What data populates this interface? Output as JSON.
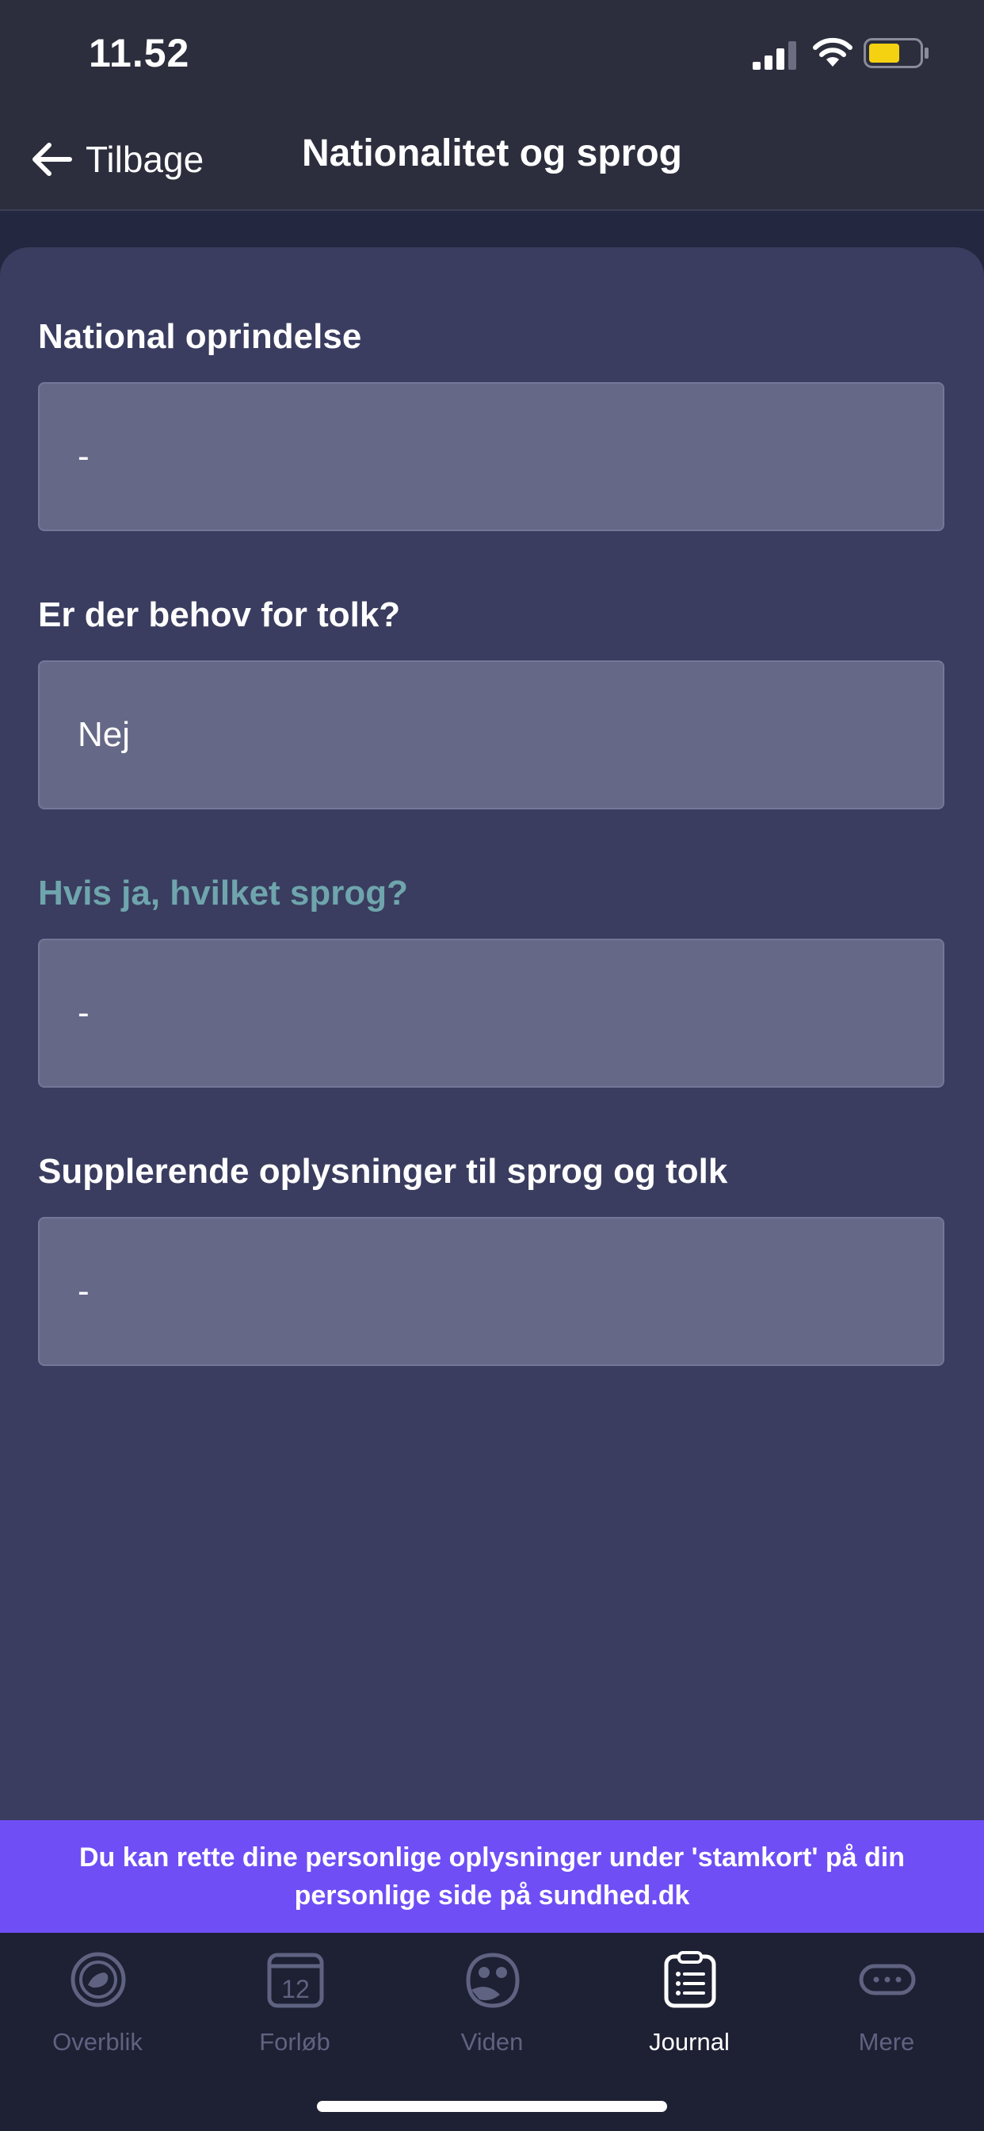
{
  "status": {
    "time": "11.52",
    "signal_icon": "cellular-signal-icon",
    "wifi_icon": "wifi-icon",
    "battery_icon": "battery-icon",
    "battery_color": "#f5d211"
  },
  "nav": {
    "back_label": "Tilbage",
    "back_icon": "arrow-left-icon",
    "title": "Nationalitet og sprog"
  },
  "form": {
    "fields": [
      {
        "label": "National oprindelse",
        "value": "-"
      },
      {
        "label": "Er der behov for tolk?",
        "value": "Nej"
      },
      {
        "label": "Hvis ja, hvilket sprog?",
        "value": "-",
        "label_color": "#6fa5ad"
      },
      {
        "label": "Supplerende oplysninger til sprog og tolk",
        "value": "-"
      }
    ]
  },
  "banner": {
    "text": "Du kan rette dine personlige oplysninger under 'stamkort' på din personlige side på sundhed.dk",
    "color": "#6f4ef6"
  },
  "tabs": [
    {
      "label": "Overblik",
      "icon": "baby-face-icon",
      "active": false
    },
    {
      "label": "Forløb",
      "icon": "calendar-icon",
      "active": false,
      "icon_text": "12"
    },
    {
      "label": "Viden",
      "icon": "owl-icon",
      "active": false
    },
    {
      "label": "Journal",
      "icon": "clipboard-list-icon",
      "active": true
    },
    {
      "label": "Mere",
      "icon": "more-dots-icon",
      "active": false
    }
  ]
}
